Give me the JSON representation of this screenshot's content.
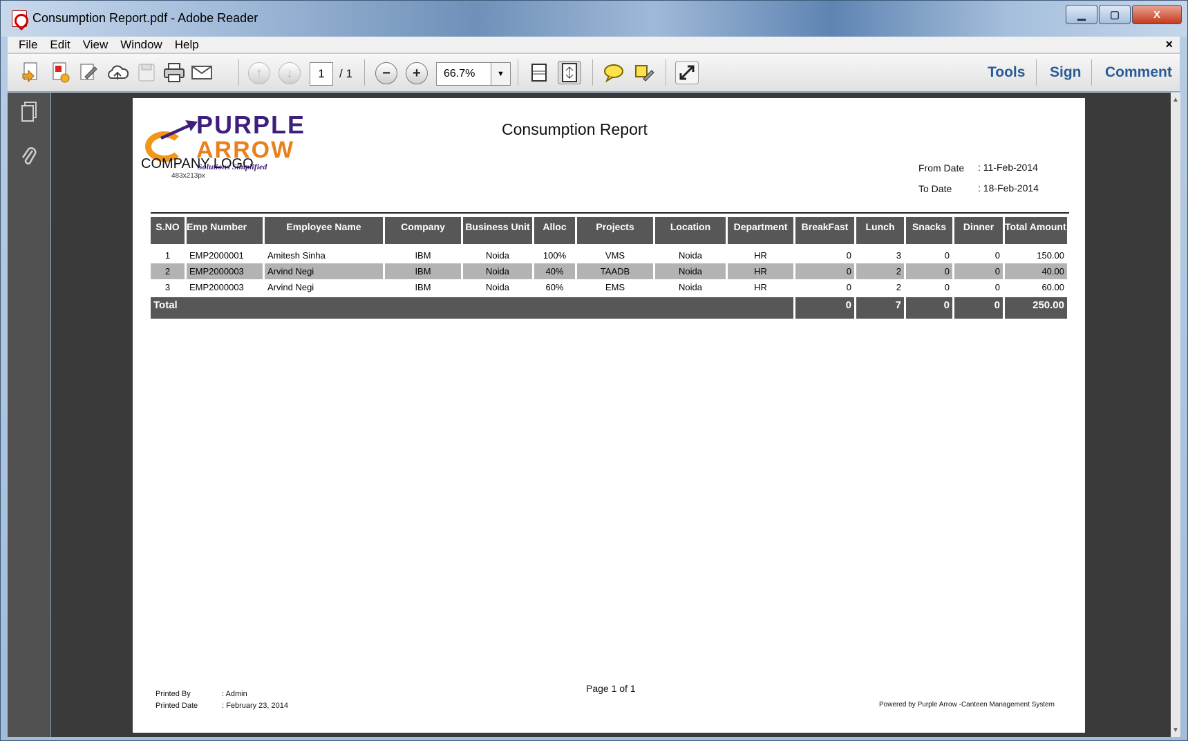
{
  "window": {
    "title": "Consumption Report.pdf - Adobe Reader",
    "controls": {
      "minimize": "▁",
      "maximize": "▢",
      "close": "X"
    }
  },
  "menu": {
    "items": [
      "File",
      "Edit",
      "View",
      "Window",
      "Help"
    ],
    "close_glyph": "×"
  },
  "toolbar": {
    "icons": [
      "create-pdf-icon",
      "combine-files-icon",
      "edit-pdf-icon",
      "cloud-upload-icon",
      "save-icon",
      "print-icon",
      "email-icon",
      "prev-page-icon",
      "next-page-icon",
      "zoom-out-icon",
      "zoom-in-icon",
      "fit-width-icon",
      "fit-page-icon",
      "comment-bubble-icon",
      "highlight-icon",
      "fullscreen-icon"
    ],
    "current_page": "1",
    "total_pages": "/ 1",
    "zoom": "66.7%",
    "links": {
      "tools": "Tools",
      "sign": "Sign",
      "comment": "Comment"
    }
  },
  "left_nav": {
    "icons": [
      "pages-icon",
      "attachments-icon"
    ]
  },
  "report": {
    "logo": {
      "line1": "PURPLE",
      "line2": "ARROW",
      "tagline": "Solutions Simplified",
      "label": "COMPANY LOGO",
      "size_note": "483x213px"
    },
    "title": "Consumption Report",
    "from_date_label": "From Date",
    "from_date_value": ": 11-Feb-2014",
    "to_date_label": "To Date",
    "to_date_value": ": 18-Feb-2014",
    "columns": [
      "S.NO",
      "Emp Number",
      "Employee Name",
      "Company",
      "Business Unit",
      "Alloc",
      "Projects",
      "Location",
      "Department",
      "BreakFast",
      "Lunch",
      "Snacks",
      "Dinner",
      "Total Amount"
    ],
    "rows": [
      [
        "1",
        "EMP2000001",
        "Amitesh Sinha",
        "IBM",
        "Noida",
        "100%",
        "VMS",
        "Noida",
        "HR",
        "0",
        "3",
        "0",
        "0",
        "150.00"
      ],
      [
        "2",
        "EMP2000003",
        "Arvind  Negi",
        "IBM",
        "Noida",
        "40%",
        "TAADB",
        "Noida",
        "HR",
        "0",
        "2",
        "0",
        "0",
        "40.00"
      ],
      [
        "3",
        "EMP2000003",
        "Arvind  Negi",
        "IBM",
        "Noida",
        "60%",
        "EMS",
        "Noida",
        "HR",
        "0",
        "2",
        "0",
        "0",
        "60.00"
      ]
    ],
    "total": {
      "label": "Total",
      "breakfast": "0",
      "lunch": "7",
      "snacks": "0",
      "dinner": "0",
      "amount": "250.00"
    },
    "footer": {
      "printed_by_label": "Printed By",
      "printed_by_value": ": Admin",
      "printed_date_label": "Printed Date",
      "printed_date_value": ": February 23, 2014",
      "page_count": "Page 1 of 1",
      "powered_by": "Powered by Purple Arrow -Canteen Management System"
    }
  }
}
